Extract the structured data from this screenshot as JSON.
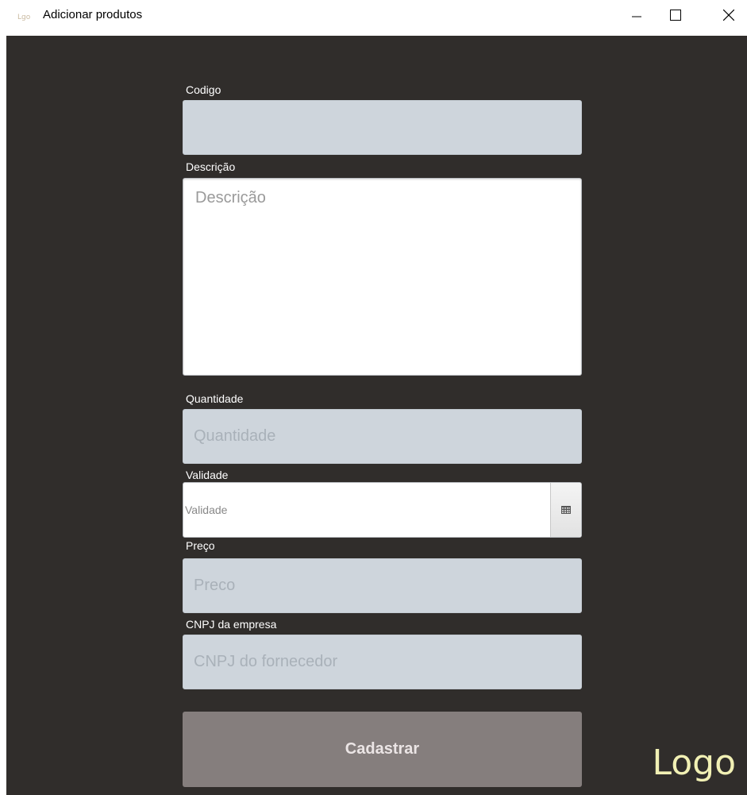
{
  "window": {
    "title": "Adicionar produtos",
    "icon": "app-logo-icon",
    "controls": [
      "minimize-icon",
      "maximize-icon",
      "close-icon"
    ]
  },
  "form": {
    "codigo": {
      "label": "Codigo",
      "placeholder": ""
    },
    "descricao": {
      "label": "Descrição",
      "placeholder": "Descrição"
    },
    "quantidade": {
      "label": "Quantidade",
      "placeholder": "Quantidade"
    },
    "validade": {
      "label": "Validade",
      "placeholder": "Validade",
      "button_icon": "calendar-icon"
    },
    "preco": {
      "label": "Preço",
      "placeholder": "Preco"
    },
    "cnpj": {
      "label": "CNPJ da empresa",
      "placeholder": "CNPJ do fornecedor"
    },
    "submit_label": "Cadastrar"
  },
  "logo_text": "Logo",
  "colors": {
    "background": "#302d2b",
    "input_grey": "#ced5dc",
    "button": "#857e7d",
    "logo": "#f1f0b4"
  }
}
